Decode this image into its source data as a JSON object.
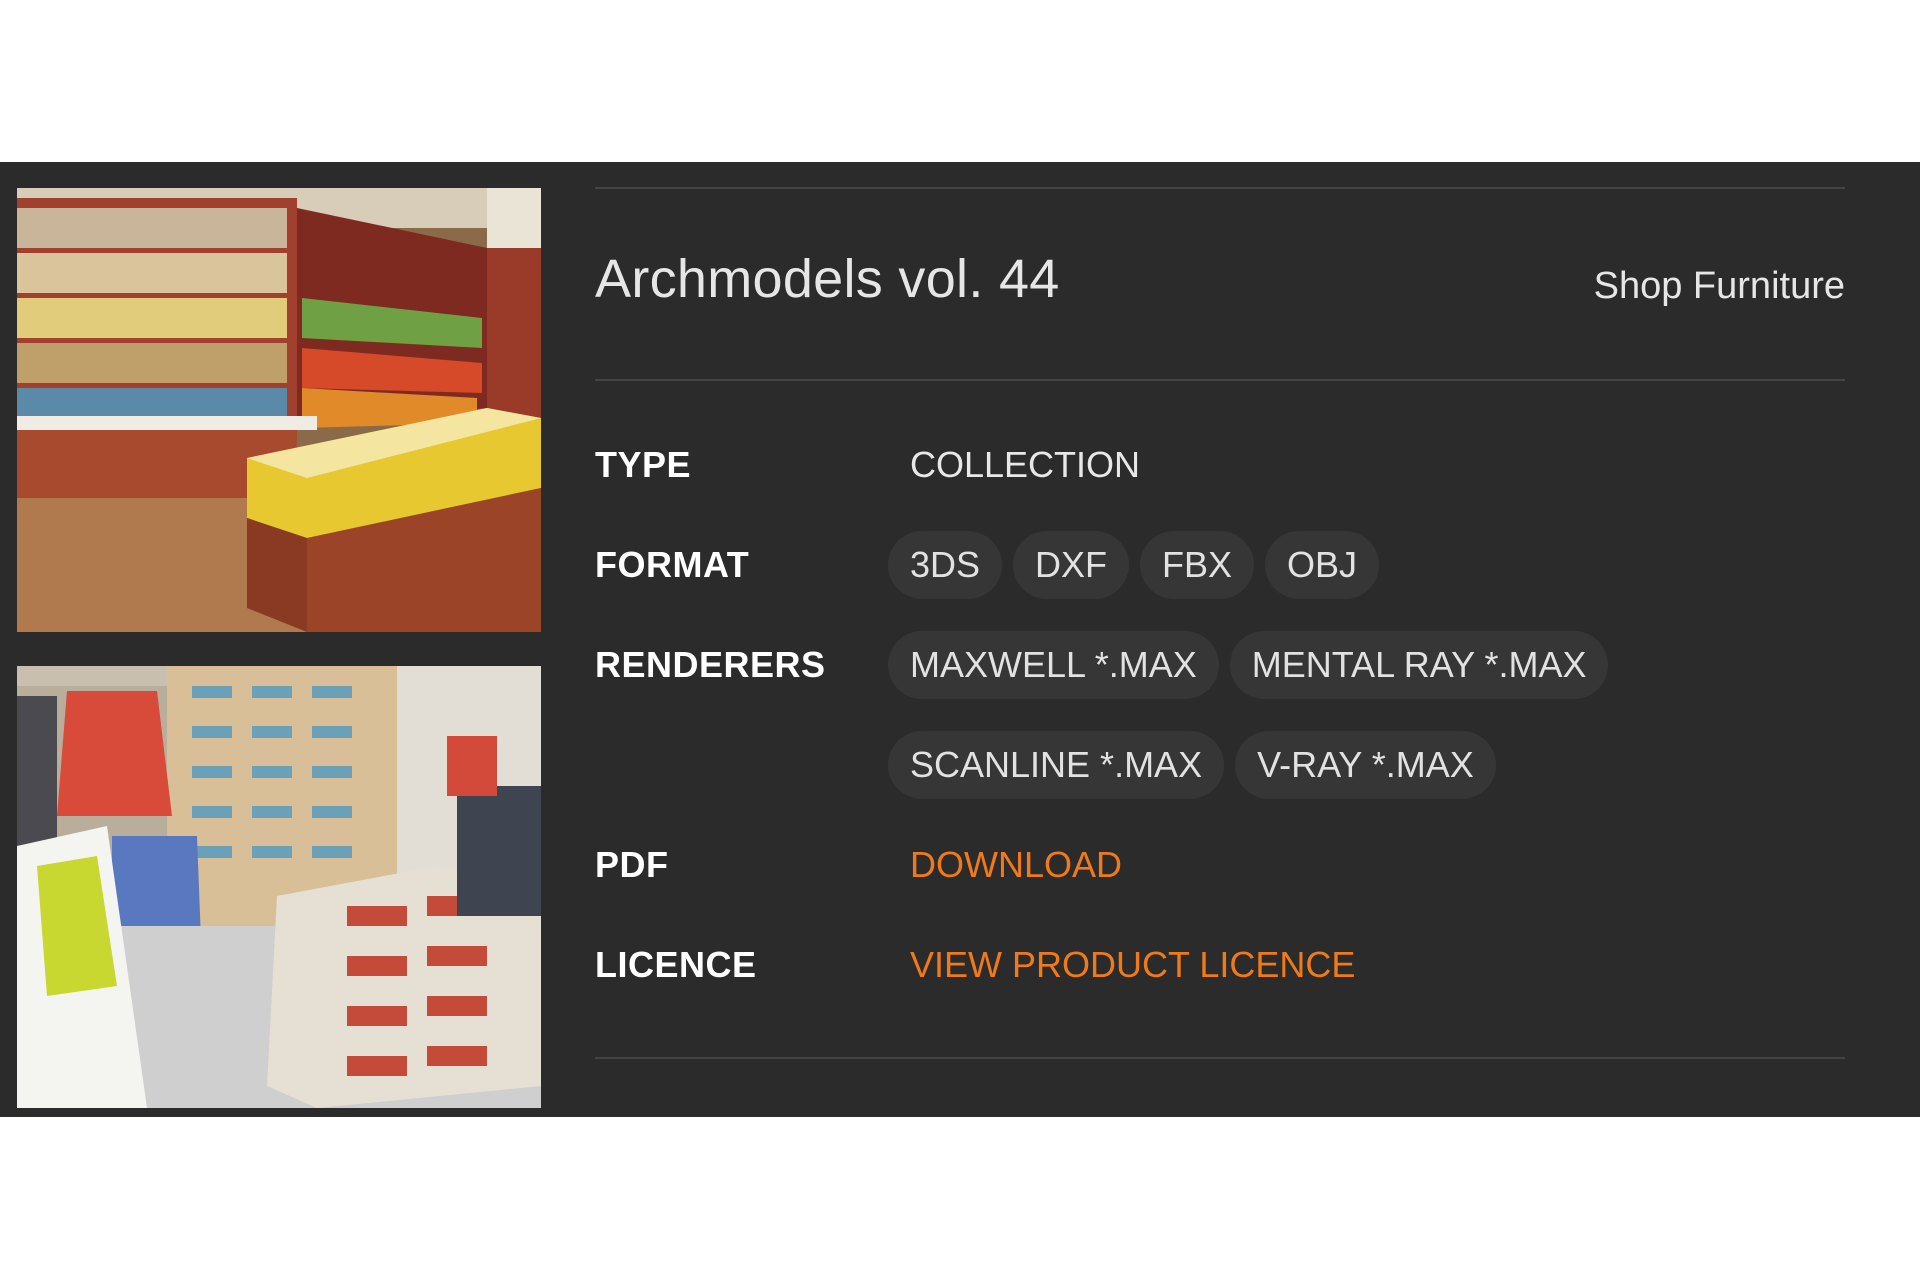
{
  "product": {
    "title": "Archmodels vol. 44",
    "category": "Shop Furniture"
  },
  "details": {
    "type": {
      "label": "TYPE",
      "value": "COLLECTION"
    },
    "format": {
      "label": "FORMAT",
      "tags": [
        "3DS",
        "DXF",
        "FBX",
        "OBJ"
      ]
    },
    "renderers": {
      "label": "RENDERERS",
      "tags_row1": [
        "MAXWELL *.MAX",
        "MENTAL RAY *.MAX"
      ],
      "tags_row2": [
        "SCANLINE *.MAX",
        "V-RAY *.MAX"
      ]
    },
    "pdf": {
      "label": "PDF",
      "link": "DOWNLOAD"
    },
    "licence": {
      "label": "LICENCE",
      "link": "VIEW PRODUCT LICENCE"
    }
  },
  "images": [
    {
      "icon": "grocery-store-render"
    },
    {
      "icon": "clothing-shoe-store-render"
    }
  ],
  "colors": {
    "panel_bg": "#2b2b2b",
    "accent_link": "#f07a1a",
    "tag_bg": "#363636"
  }
}
